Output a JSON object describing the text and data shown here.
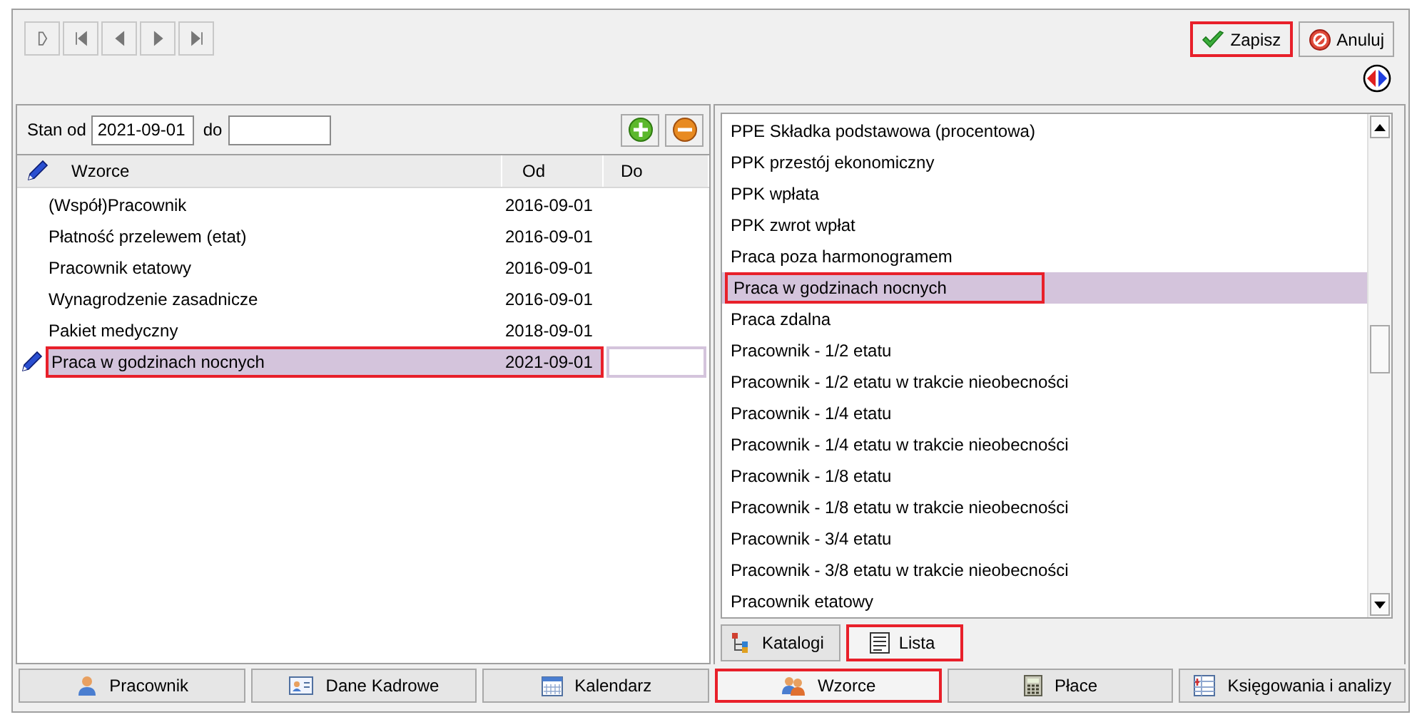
{
  "actions": [
    {
      "label": "Zapisz",
      "kind": "save",
      "highlighted": true
    },
    {
      "label": "Anuluj",
      "kind": "cancel",
      "highlighted": false
    }
  ],
  "filter": {
    "from_label": "Stan od",
    "from_value": "2021-09-01",
    "to_label": "do"
  },
  "table": {
    "columns": [
      "Wzorce",
      "Od",
      "Do"
    ],
    "rows": [
      {
        "name": "(Współ)Pracownik",
        "od": "2016-09-01",
        "selected": false,
        "highlighted": false
      },
      {
        "name": "Płatność przelewem (etat)",
        "od": "2016-09-01",
        "selected": false,
        "highlighted": false
      },
      {
        "name": "Pracownik etatowy",
        "od": "2016-09-01",
        "selected": false,
        "highlighted": false
      },
      {
        "name": "Wynagrodzenie zasadnicze",
        "od": "2016-09-01",
        "selected": false,
        "highlighted": false
      },
      {
        "name": "Pakiet medyczny",
        "od": "2018-09-01",
        "selected": false,
        "highlighted": false
      },
      {
        "name": "Praca w godzinach nocnych",
        "od": "2021-09-01",
        "selected": true,
        "highlighted": true
      }
    ]
  },
  "list": {
    "items": [
      {
        "label": "PPE Składka podstawowa (procentowa)",
        "selected": false,
        "highlighted": false
      },
      {
        "label": "PPK przestój ekonomiczny",
        "selected": false,
        "highlighted": false
      },
      {
        "label": "PPK wpłata",
        "selected": false,
        "highlighted": false
      },
      {
        "label": "PPK zwrot wpłat",
        "selected": false,
        "highlighted": false
      },
      {
        "label": "Praca poza harmonogramem",
        "selected": false,
        "highlighted": false
      },
      {
        "label": "Praca w godzinach nocnych",
        "selected": true,
        "highlighted": true
      },
      {
        "label": "Praca zdalna",
        "selected": false,
        "highlighted": false
      },
      {
        "label": "Pracownik - 1/2 etatu",
        "selected": false,
        "highlighted": false
      },
      {
        "label": "Pracownik - 1/2 etatu w trakcie nieobecności",
        "selected": false,
        "highlighted": false
      },
      {
        "label": "Pracownik - 1/4 etatu",
        "selected": false,
        "highlighted": false
      },
      {
        "label": "Pracownik - 1/4 etatu w trakcie nieobecności",
        "selected": false,
        "highlighted": false
      },
      {
        "label": "Pracownik - 1/8 etatu",
        "selected": false,
        "highlighted": false
      },
      {
        "label": "Pracownik - 1/8 etatu w trakcie nieobecności",
        "selected": false,
        "highlighted": false
      },
      {
        "label": "Pracownik - 3/4 etatu",
        "selected": false,
        "highlighted": false
      },
      {
        "label": "Pracownik - 3/8 etatu w trakcie nieobecności",
        "selected": false,
        "highlighted": false
      },
      {
        "label": "Pracownik etatowy",
        "selected": false,
        "highlighted": false
      }
    ]
  },
  "list_tabs": [
    {
      "label": "Katalogi",
      "kind": "tree",
      "selected": false,
      "highlighted": false
    },
    {
      "label": "Lista",
      "kind": "list",
      "selected": true,
      "highlighted": true
    }
  ],
  "bottom_tabs": [
    {
      "label": "Pracownik",
      "kind": "person",
      "selected": false,
      "highlighted": false
    },
    {
      "label": "Dane Kadrowe",
      "kind": "card",
      "selected": false,
      "highlighted": false
    },
    {
      "label": "Kalendarz",
      "kind": "calendar",
      "selected": false,
      "highlighted": false
    },
    {
      "label": "Wzorce",
      "kind": "people",
      "selected": true,
      "highlighted": true
    },
    {
      "label": "Płace",
      "kind": "calculator",
      "selected": false,
      "highlighted": false
    },
    {
      "label": "Księgowania i analizy",
      "kind": "ledger",
      "selected": false,
      "highlighted": false
    }
  ]
}
